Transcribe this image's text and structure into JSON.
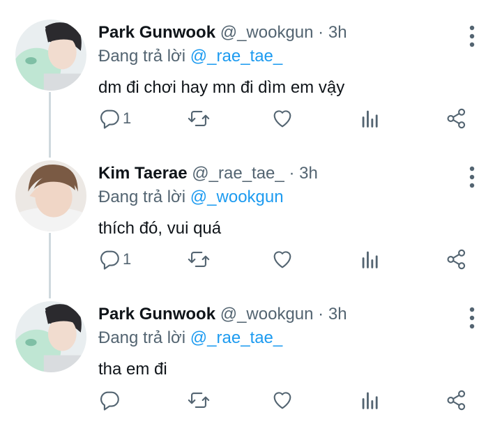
{
  "colors": {
    "accent": "#1d9bf0",
    "text_primary": "#0f1419",
    "text_secondary": "#536471",
    "thread_line": "#cfd9de"
  },
  "tweets": [
    {
      "display_name": "Park Gunwook",
      "handle": "@_wookgun",
      "dot": "·",
      "time": "3h",
      "reply_prefix": "Đang trả lời",
      "reply_handle": "@_rae_tae_",
      "text": "dm đi chơi hay mn đi dìm em vậy",
      "reply_count": "1",
      "avatar": "avatar-park-gunwook"
    },
    {
      "display_name": "Kim Taerae",
      "handle": "@_rae_tae_",
      "dot": "·",
      "time": "3h",
      "reply_prefix": "Đang trả lời",
      "reply_handle": "@_wookgun",
      "text": "thích đó, vui quá",
      "reply_count": "1",
      "avatar": "avatar-kim-taerae"
    },
    {
      "display_name": "Park Gunwook",
      "handle": "@_wookgun",
      "dot": "·",
      "time": "3h",
      "reply_prefix": "Đang trả lời",
      "reply_handle": "@_rae_tae_",
      "text": "tha em đi",
      "reply_count": "",
      "avatar": "avatar-park-gunwook"
    }
  ],
  "icons": {
    "more": "more-vertical-icon",
    "reply": "reply-icon",
    "retweet": "retweet-icon",
    "like": "heart-icon",
    "views": "analytics-icon",
    "share": "share-icon"
  }
}
